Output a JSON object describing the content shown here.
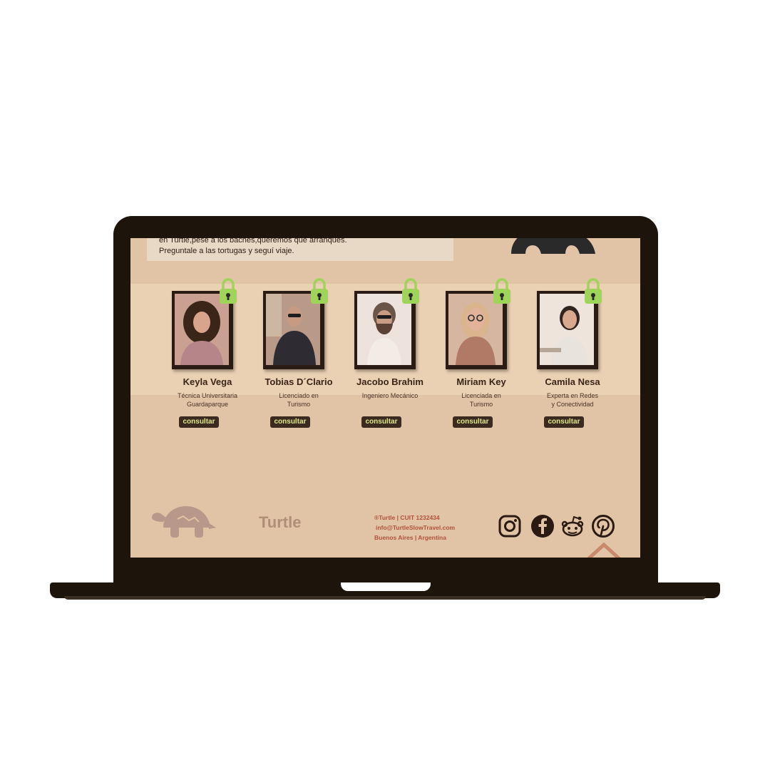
{
  "intro": {
    "line1": "en Turtle,pese a los baches,queremos que arranques.",
    "line2": "Preguntale a las tortugas y seguí viaje."
  },
  "team": [
    {
      "name": "Keyla Vega",
      "role1": "Técnica Universitaria",
      "role2": "Guardaparque",
      "button": "consultar"
    },
    {
      "name": "Tobias D´Clario",
      "role1": "Licenciado en",
      "role2": "Turismo",
      "button": "consultar"
    },
    {
      "name": "Jacobo Brahim",
      "role1": "Ingeniero Mecánico",
      "role2": "",
      "button": "consultar"
    },
    {
      "name": "Miriam Key",
      "role1": "Licenciada en",
      "role2": "Turismo",
      "button": "consultar"
    },
    {
      "name": "Camila Nesa",
      "role1": "Experta en Redes",
      "role2": "y Conectividad",
      "button": "consultar"
    }
  ],
  "footer": {
    "brand": "Turtle",
    "copyright": "®Turtle | CUIT 1232434",
    "email": "info@TurtleSlowTravel.com",
    "location": "Buenos Aires | Argentina",
    "social_icons": [
      "instagram-icon",
      "facebook-icon",
      "reddit-icon",
      "pinterest-icon"
    ]
  },
  "colors": {
    "page_bg": "#e1c3a5",
    "band_bg": "#ebd1b3",
    "laptop": "#1d140c",
    "button_bg": "#3a2a20",
    "button_text": "#dfe78a",
    "lock": "#9fd45a",
    "footer_text": "#b0533b",
    "brand_text": "#b08f78"
  }
}
